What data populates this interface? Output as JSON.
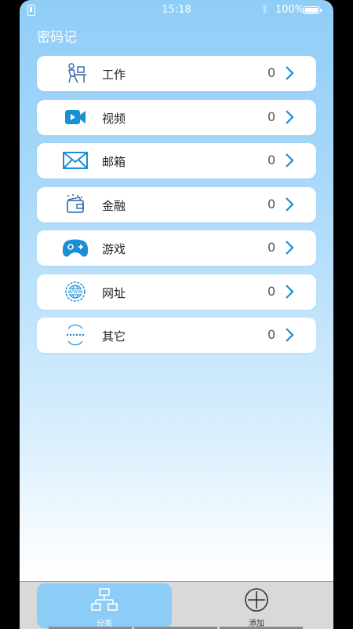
{
  "status": {
    "time": "15:18",
    "battery": "100%"
  },
  "app": {
    "title": "密码记"
  },
  "categories": [
    {
      "label": "工作",
      "count": "0",
      "icon": "worker-desk-icon"
    },
    {
      "label": "视频",
      "count": "0",
      "icon": "video-camera-icon"
    },
    {
      "label": "邮箱",
      "count": "0",
      "icon": "mail-envelope-icon"
    },
    {
      "label": "金融",
      "count": "0",
      "icon": "wallet-icon"
    },
    {
      "label": "游戏",
      "count": "0",
      "icon": "gamepad-icon"
    },
    {
      "label": "网址",
      "count": "0",
      "icon": "globe-www-icon"
    },
    {
      "label": "其它",
      "count": "0",
      "icon": "more-dots-icon"
    }
  ],
  "tabs": {
    "category_label": "分类",
    "add_label": "添加"
  },
  "colors": {
    "accent": "#1a8fd6",
    "active_tab": "#8ccdf7",
    "header_bg": "#8fcdf7"
  }
}
